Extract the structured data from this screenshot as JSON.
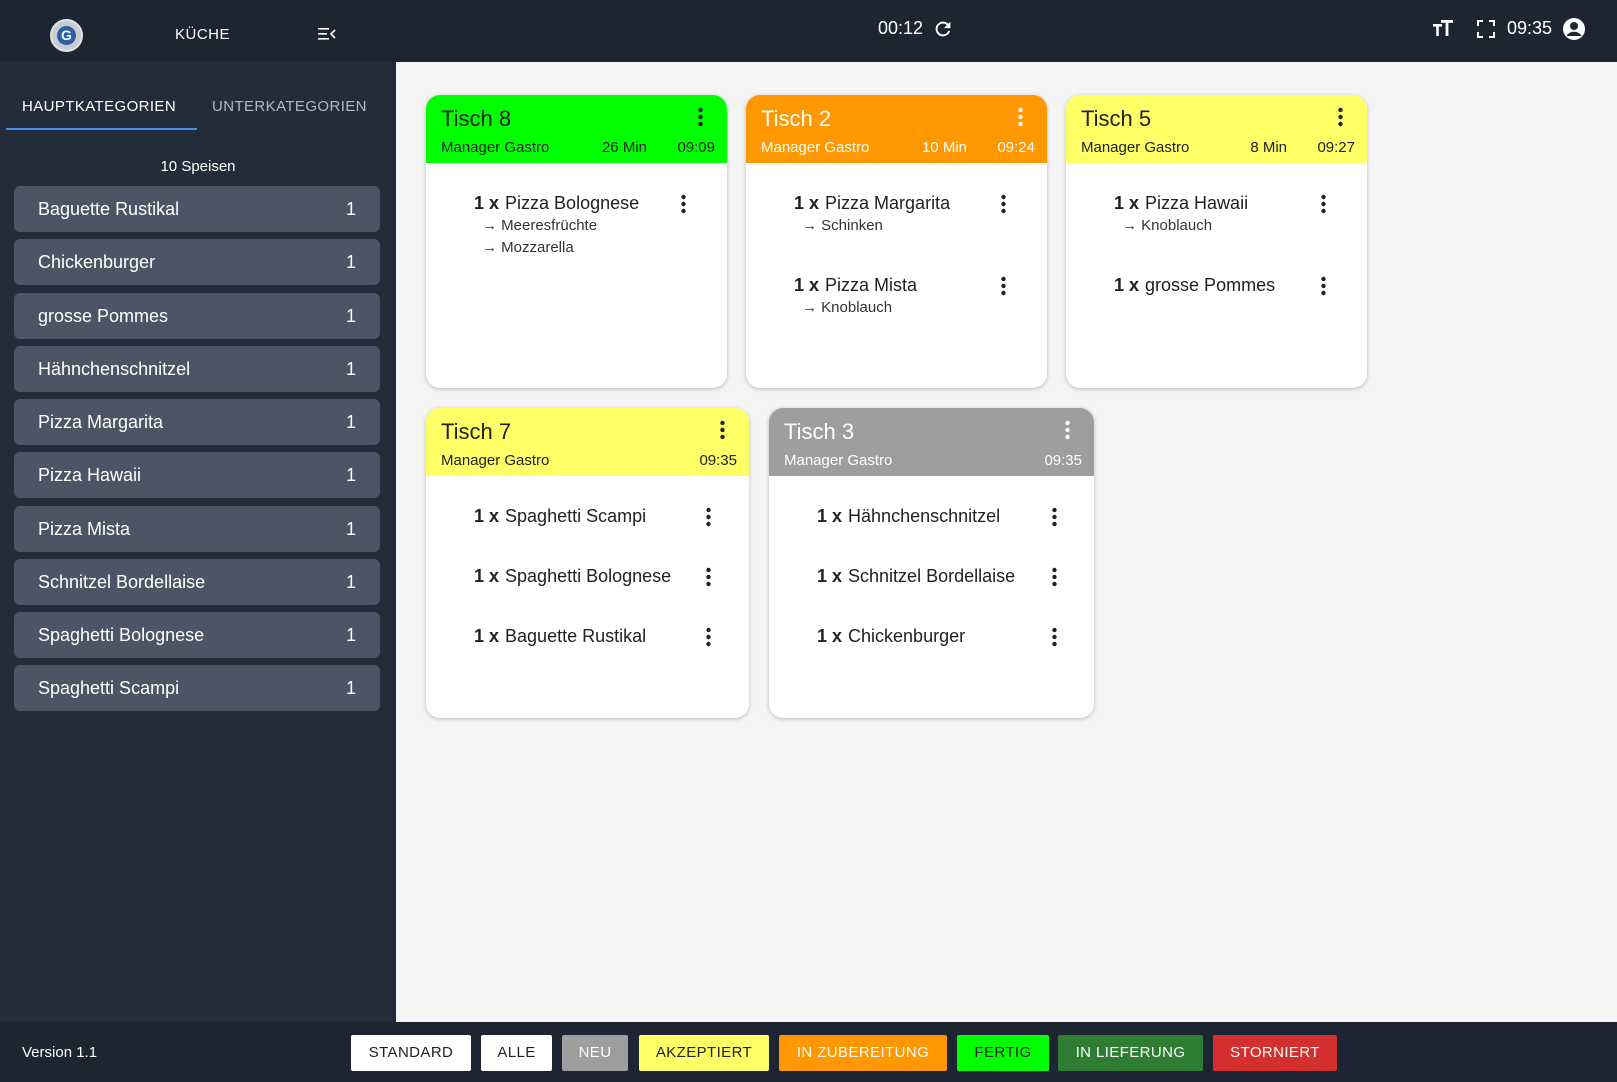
{
  "topbar": {
    "logo_letter": "G",
    "app_title": "KÜCHE",
    "timer": "00:12",
    "clock": "09:35"
  },
  "sidebar": {
    "tabs": [
      {
        "label": "HAUPTKATEGORIEN",
        "active": true
      },
      {
        "label": "UNTERKATEGORIEN",
        "active": false
      }
    ],
    "count_label": "10 Speisen",
    "items": [
      {
        "label": "Baguette Rustikal",
        "count": "1"
      },
      {
        "label": "Chickenburger",
        "count": "1"
      },
      {
        "label": "grosse Pommes",
        "count": "1"
      },
      {
        "label": "Hähnchenschnitzel",
        "count": "1"
      },
      {
        "label": "Pizza Margarita",
        "count": "1"
      },
      {
        "label": "Pizza Hawaii",
        "count": "1"
      },
      {
        "label": "Pizza Mista",
        "count": "1"
      },
      {
        "label": "Schnitzel Bordellaise",
        "count": "1"
      },
      {
        "label": "Spaghetti Bolognese",
        "count": "1"
      },
      {
        "label": "Spaghetti Scampi",
        "count": "1"
      }
    ]
  },
  "cards": [
    {
      "title": "Tisch 8",
      "user": "Manager Gastro",
      "minutes": "26 Min",
      "time": "09:09",
      "color": "#00ff00",
      "items": [
        {
          "qty": "1 x",
          "name": "Pizza Bolognese",
          "mods": [
            "→ Meeresfrüchte",
            "→ Mozzarella"
          ]
        }
      ]
    },
    {
      "title": "Tisch 2",
      "user": "Manager Gastro",
      "minutes": "10 Min",
      "time": "09:24",
      "color": "#ff9800",
      "items": [
        {
          "qty": "1 x",
          "name": "Pizza Margarita",
          "mods": [
            "→ Schinken"
          ]
        },
        {
          "qty": "1 x",
          "name": "Pizza Mista",
          "mods": [
            "→ Knoblauch"
          ]
        }
      ]
    },
    {
      "title": "Tisch 5",
      "user": "Manager Gastro",
      "minutes": "8 Min",
      "time": "09:27",
      "color": "#ffff66",
      "items": [
        {
          "qty": "1 x",
          "name": "Pizza Hawaii",
          "mods": [
            "→ Knoblauch"
          ]
        },
        {
          "qty": "1 x",
          "name": "grosse Pommes",
          "mods": []
        }
      ]
    },
    {
      "title": "Tisch 7",
      "user": "Manager Gastro",
      "minutes": "",
      "time": "09:35",
      "color": "#ffff66",
      "items": [
        {
          "qty": "1 x",
          "name": "Spaghetti Scampi",
          "mods": []
        },
        {
          "qty": "1 x",
          "name": "Spaghetti Bolognese",
          "mods": []
        },
        {
          "qty": "1 x",
          "name": "Baguette Rustikal",
          "mods": []
        }
      ]
    },
    {
      "title": "Tisch 3",
      "user": "Manager Gastro",
      "minutes": "",
      "time": "09:35",
      "color": "#9e9e9e",
      "items": [
        {
          "qty": "1 x",
          "name": "Hähnchenschnitzel",
          "mods": []
        },
        {
          "qty": "1 x",
          "name": "Schnitzel Bordellaise",
          "mods": []
        },
        {
          "qty": "1 x",
          "name": "Chickenburger",
          "mods": []
        }
      ]
    }
  ],
  "footer": {
    "version": "Version 1.1",
    "filters": [
      {
        "label": "STANDARD",
        "bg": "#ffffff",
        "fg": "#212121"
      },
      {
        "label": "ALLE",
        "bg": "#ffffff",
        "fg": "#212121"
      },
      {
        "label": "NEU",
        "bg": "#9e9e9e",
        "fg": "#ffffff"
      },
      {
        "label": "AKZEPTIERT",
        "bg": "#ffff66",
        "fg": "#212121"
      },
      {
        "label": "IN ZUBEREITUNG",
        "bg": "#ff9800",
        "fg": "#ffffff"
      },
      {
        "label": "FERTIG",
        "bg": "#00ff00",
        "fg": "#212121"
      },
      {
        "label": "IN LIEFERUNG",
        "bg": "#2e7d32",
        "fg": "#ffffff"
      },
      {
        "label": "STORNIERT",
        "bg": "#d32f2f",
        "fg": "#ffffff"
      }
    ]
  }
}
